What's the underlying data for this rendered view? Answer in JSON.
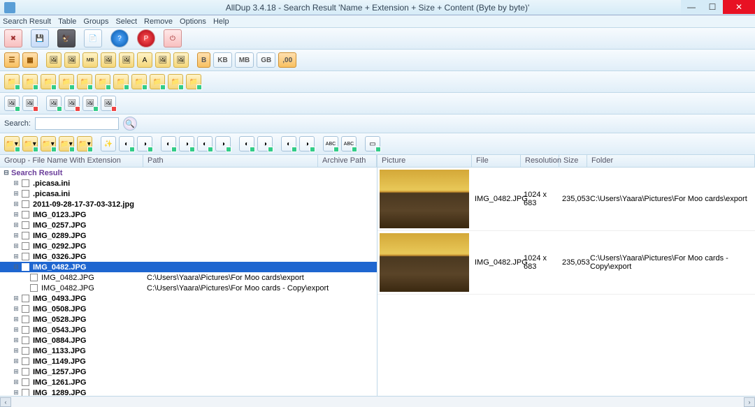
{
  "titlebar": {
    "title": "AllDup 3.4.18 - Search Result 'Name + Extension + Size + Content (Byte by byte)'"
  },
  "menu": [
    "Search Result",
    "Table",
    "Groups",
    "Select",
    "Remove",
    "Options",
    "Help"
  ],
  "size_buttons": {
    "b": "B",
    "kb": "KB",
    "mb": "MB",
    "gb": "GB",
    "dec": ",00"
  },
  "search": {
    "label": "Search:",
    "value": ""
  },
  "tree_headers": {
    "group": "Group - File Name With Extension",
    "path": "Path",
    "archive": "Archive Path"
  },
  "tree": {
    "root": "Search Result",
    "groups": [
      {
        "name": ".picasa.ini",
        "bold": true
      },
      {
        "name": ".picasa.ini",
        "bold": true
      },
      {
        "name": "2011-09-28-17-37-03-312.jpg",
        "bold": true
      },
      {
        "name": "IMG_0123.JPG",
        "bold": true
      },
      {
        "name": "IMG_0257.JPG",
        "bold": true
      },
      {
        "name": "IMG_0289.JPG",
        "bold": true
      },
      {
        "name": "IMG_0292.JPG",
        "bold": true
      },
      {
        "name": "IMG_0326.JPG",
        "bold": true
      },
      {
        "name": "IMG_0482.JPG",
        "bold": true,
        "selected": true,
        "expanded": true,
        "children": [
          {
            "name": "IMG_0482.JPG",
            "path": "C:\\Users\\Yaara\\Pictures\\For Moo cards\\export"
          },
          {
            "name": "IMG_0482.JPG",
            "path": "C:\\Users\\Yaara\\Pictures\\For Moo cards - Copy\\export"
          }
        ]
      },
      {
        "name": "IMG_0493.JPG",
        "bold": true
      },
      {
        "name": "IMG_0508.JPG",
        "bold": true
      },
      {
        "name": "IMG_0528.JPG",
        "bold": true
      },
      {
        "name": "IMG_0543.JPG",
        "bold": true
      },
      {
        "name": "IMG_0884.JPG",
        "bold": true
      },
      {
        "name": "IMG_1133.JPG",
        "bold": true
      },
      {
        "name": "IMG_1149.JPG",
        "bold": true
      },
      {
        "name": "IMG_1257.JPG",
        "bold": true
      },
      {
        "name": "IMG_1261.JPG",
        "bold": true
      },
      {
        "name": "IMG_1289.JPG",
        "bold": true
      }
    ]
  },
  "detail_headers": {
    "picture": "Picture",
    "file": "File",
    "resolution": "Resolution",
    "size": "Size",
    "folder": "Folder"
  },
  "details": [
    {
      "file": "IMG_0482.JPG",
      "resolution": "1024 x 683",
      "size": "235,053",
      "folder": "C:\\Users\\Yaara\\Pictures\\For Moo cards\\export"
    },
    {
      "file": "IMG_0482.JPG",
      "resolution": "1024 x 683",
      "size": "235,053",
      "folder": "C:\\Users\\Yaara\\Pictures\\For Moo cards - Copy\\export"
    }
  ]
}
